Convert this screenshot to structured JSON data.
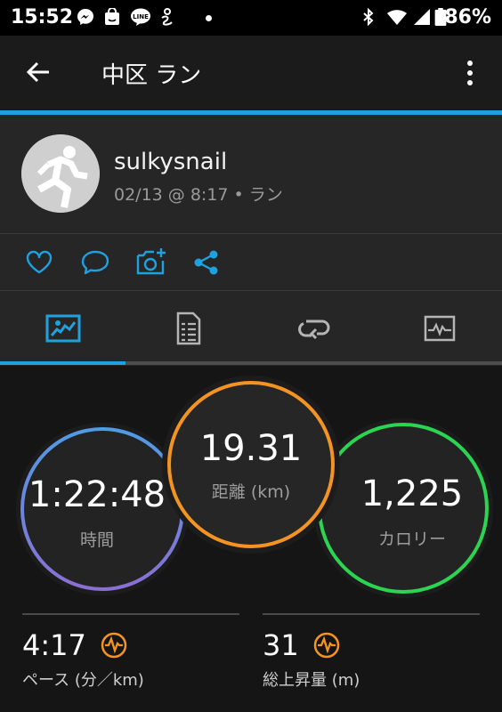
{
  "status_bar": {
    "time": "15:52",
    "battery": "86%"
  },
  "app_bar": {
    "title": "中区 ラン"
  },
  "profile": {
    "username": "sulkysnail",
    "subline": "02/13 @ 8:17 • ラン"
  },
  "stats": {
    "time": {
      "value": "1:22:48",
      "label": "時間"
    },
    "distance": {
      "value": "19.31",
      "label": "距離 (km)"
    },
    "calories": {
      "value": "1,225",
      "label": "カロリー"
    },
    "pace": {
      "value": "4:17",
      "label": "ペース (分／km)"
    },
    "elevation": {
      "value": "31",
      "label": "総上昇量 (m)"
    }
  },
  "colors": {
    "accent": "#1fa1e0",
    "time_ring": "#5c8ee0",
    "distance_ring": "#f39422",
    "calories_ring": "#2bd451",
    "badge": "#f39422"
  }
}
